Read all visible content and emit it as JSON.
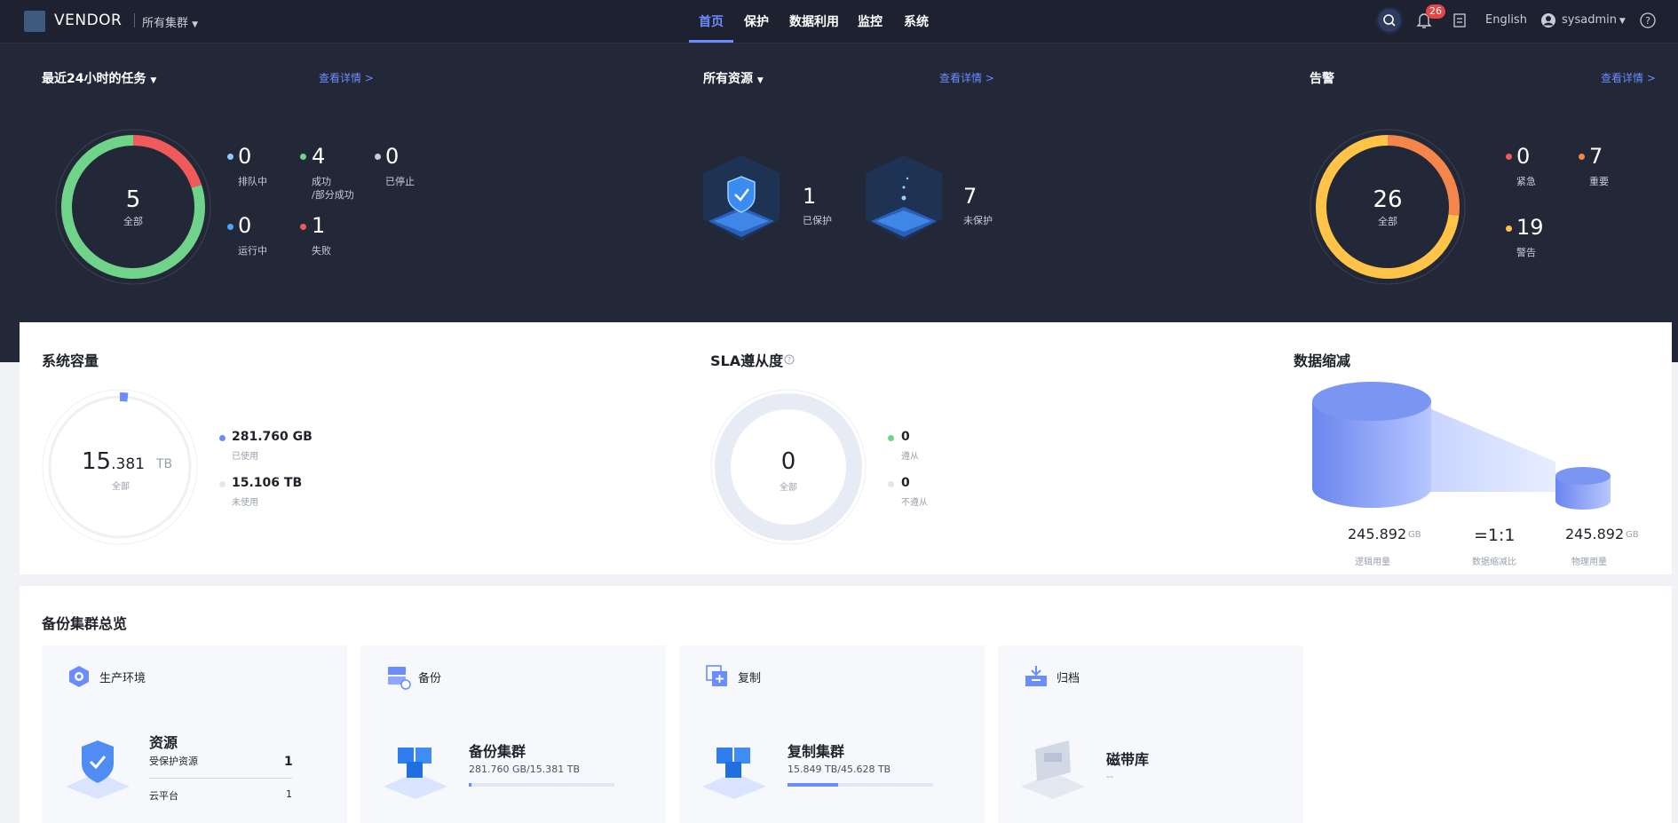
{
  "header": {
    "brand": "VENDOR",
    "cluster": "所有集群",
    "nav": [
      "首页",
      "保护",
      "数据利用",
      "监控",
      "系统"
    ],
    "notification_count": "26",
    "language": "English",
    "user": "sysadmin"
  },
  "tasks": {
    "title": "最近24小时的任务",
    "link": "查看详情 >",
    "total": "5",
    "total_label": "全部",
    "stats": [
      {
        "value": "0",
        "label": "排队中",
        "color": "#8fc9ff"
      },
      {
        "value": "4",
        "label": "成功\n/部分成功",
        "color": "#6fd38a"
      },
      {
        "value": "0",
        "label": "已停止",
        "color": "#c7ccd6"
      },
      {
        "value": "0",
        "label": "运行中",
        "color": "#4ea4ff"
      },
      {
        "value": "1",
        "label": "失败",
        "color": "#f05a5a"
      }
    ]
  },
  "resources": {
    "title": "所有资源",
    "link": "查看详情 >",
    "protected": "1",
    "protected_label": "已保护",
    "unprotected": "7",
    "unprotected_label": "未保护"
  },
  "alarms": {
    "title": "告警",
    "link": "查看详情 >",
    "total": "26",
    "total_label": "全部",
    "stats": [
      {
        "value": "0",
        "label": "紧急",
        "color": "#f05a5a"
      },
      {
        "value": "7",
        "label": "重要",
        "color": "#f5864b"
      },
      {
        "value": "19",
        "label": "警告",
        "color": "#ffc348"
      }
    ]
  },
  "capacity": {
    "title": "系统容量",
    "total_int": "15",
    "total_dec": ".381",
    "unit": "TB",
    "total_label": "全部",
    "used_value": "281.760 GB",
    "used_label": "已使用",
    "unused_value": "15.106 TB",
    "unused_label": "未使用",
    "used_fraction": 0.018
  },
  "sla": {
    "title": "SLA遵从度",
    "total": "0",
    "total_label": "全部",
    "compliant_value": "0",
    "compliant_label": "遵从",
    "noncompliant_value": "0",
    "noncompliant_label": "不遵从"
  },
  "reduction": {
    "title": "数据缩减",
    "logical_value": "245.892",
    "logical_unit": "GB",
    "logical_label": "逻辑用量",
    "ratio": "=1:1",
    "ratio_label": "数据缩减比",
    "physical_value": "245.892",
    "physical_unit": "GB",
    "physical_label": "物理用量"
  },
  "overview": {
    "title": "备份集群总览",
    "cards": [
      {
        "header": "生产环境",
        "name": "资源",
        "row1_label": "受保护资源",
        "row1_value": "1",
        "row2_label": "云平台",
        "row2_value": "1"
      },
      {
        "header": "备份",
        "name": "备份集群",
        "usage": "281.760 GB/15.381 TB",
        "fill": 0.018
      },
      {
        "header": "复制",
        "name": "复制集群",
        "usage": "15.849 TB/45.628 TB",
        "fill": 0.347
      },
      {
        "header": "归档",
        "name": "磁带库",
        "usage": "--"
      }
    ]
  },
  "colors": {
    "accent": "#6a8cff",
    "dark_bg": "#232838",
    "success": "#6fd38a",
    "fail": "#f05a5a",
    "warning": "#ffc348",
    "major": "#f5864b"
  }
}
